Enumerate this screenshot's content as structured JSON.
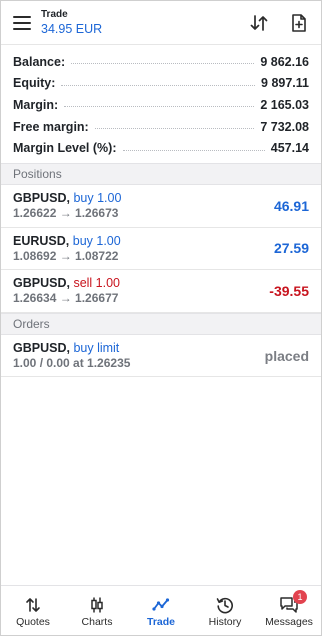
{
  "header": {
    "title": "Trade",
    "balance_subtitle": "34.95 EUR",
    "menu_icon": "hamburger-icon",
    "sort_icon": "sort-arrows-icon",
    "new_order_icon": "new-document-icon"
  },
  "summary": [
    {
      "label": "Balance:",
      "value": "9 862.16"
    },
    {
      "label": "Equity:",
      "value": "9 897.11"
    },
    {
      "label": "Margin:",
      "value": "2 165.03"
    },
    {
      "label": "Free margin:",
      "value": "7 732.08"
    },
    {
      "label": "Margin Level (%):",
      "value": "457.14"
    }
  ],
  "positions_header": "Positions",
  "positions": [
    {
      "symbol": "GBPUSD,",
      "side": "buy 1.00",
      "prices": "1.26622 → 1.26673",
      "profit": "46.91"
    },
    {
      "symbol": "EURUSD,",
      "side": "buy 1.00",
      "prices": "1.08692 → 1.08722",
      "profit": "27.59"
    },
    {
      "symbol": "GBPUSD,",
      "side": "sell 1.00",
      "prices": "1.26634 → 1.26677",
      "profit": "-39.55"
    }
  ],
  "orders_header": "Orders",
  "orders": [
    {
      "symbol": "GBPUSD,",
      "side": "buy limit",
      "details": "1.00 / 0.00 at 1.26235",
      "status": "placed"
    }
  ],
  "nav": {
    "quotes": "Quotes",
    "charts": "Charts",
    "trade": "Trade",
    "history": "History",
    "messages": "Messages",
    "messages_badge": "1"
  },
  "colors": {
    "accent": "#1c66d6",
    "loss": "#c8141e",
    "badge": "#e2434f"
  }
}
